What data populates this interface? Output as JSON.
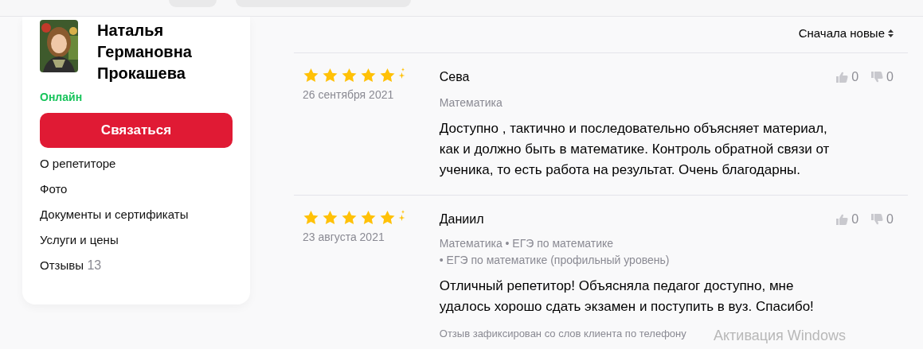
{
  "profile": {
    "name": "Наталья Германовна Прокашева",
    "status": "Онлайн",
    "online": true,
    "contact_button": "Связаться",
    "nav": [
      {
        "label": "О репетиторе"
      },
      {
        "label": "Фото"
      },
      {
        "label": "Документы и сертификаты"
      },
      {
        "label": "Услуги и цены"
      },
      {
        "label": "Отзывы",
        "count": "13"
      }
    ]
  },
  "sort": {
    "label": "Сначала новые"
  },
  "reviews": [
    {
      "stars": 5,
      "date": "26 сентября 2021",
      "author": "Сева",
      "subjects": [
        "Математика"
      ],
      "text": "Доступно , тактично и последовательно объясняет материал, как и должно быть в математике. Контроль обратной связи от ученика, то есть работа на результат. Очень благодарны.",
      "likes": "0",
      "dislikes": "0"
    },
    {
      "stars": 5,
      "date": "23 августа 2021",
      "author": "Даниил",
      "subjects": [
        "Математика • ЕГЭ по математике",
        "• ЕГЭ по математике (профильный уровень)"
      ],
      "text": "Отличный репетитор! Объясняла педагог доступно, мне удалось хорошо сдать экзамен и поступить в вуз. Спасибо!",
      "note": "Отзыв зафиксирован со слов клиента по телефону",
      "likes": "0",
      "dislikes": "0"
    }
  ],
  "os_notice": "Активация Windows"
}
